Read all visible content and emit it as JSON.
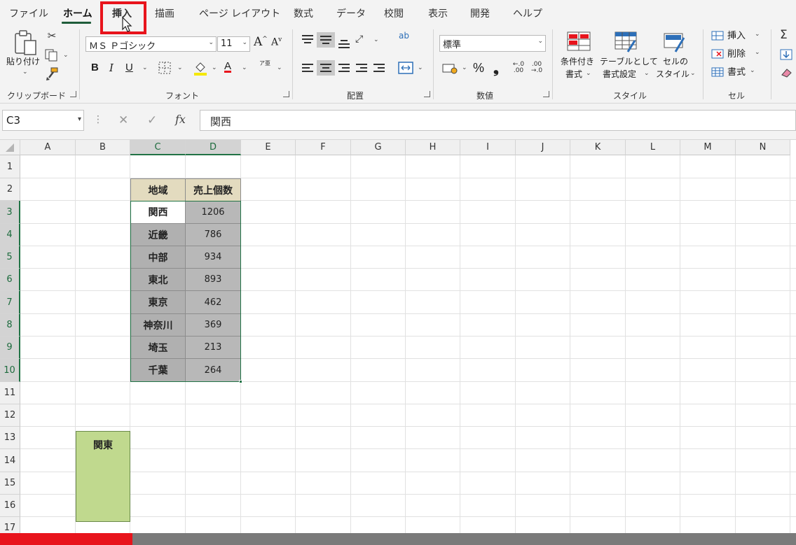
{
  "menu": {
    "tabs": [
      "ファイル",
      "ホーム",
      "挿入",
      "描画",
      "ページ レイアウト",
      "数式",
      "データ",
      "校閲",
      "表示",
      "開発",
      "ヘルプ"
    ],
    "active": "ホーム",
    "highlighted": "挿入"
  },
  "ribbon": {
    "clipboard": {
      "paste_label": "貼り付け",
      "group": "クリップボード"
    },
    "font": {
      "name": "ＭＳ Ｐゴシック",
      "size": "11",
      "bold": "B",
      "italic": "I",
      "underline": "U",
      "group": "フォント",
      "grow": "A",
      "shrink": "A",
      "color_letter": "A",
      "phonetic": "ア亜"
    },
    "alignment": {
      "group": "配置",
      "wrap_icon": "ab"
    },
    "number": {
      "format": "標準",
      "group": "数値",
      "percent": "%",
      "comma": "❟"
    },
    "styles": {
      "conditional": "条件付き\n書式",
      "conditional_line1": "条件付き",
      "conditional_line2": "書式",
      "table_line1": "テーブルとして",
      "table_line2": "書式設定",
      "cell_line1": "セルの",
      "cell_line2": "スタイル",
      "group": "スタイル"
    },
    "cells": {
      "insert": "挿入",
      "delete": "削除",
      "format": "書式",
      "group": "セル"
    }
  },
  "formula_bar": {
    "name_box": "C3",
    "fx": "fx",
    "value": "関西"
  },
  "sheet": {
    "columns": [
      "A",
      "B",
      "C",
      "D",
      "E",
      "F",
      "G",
      "H",
      "I",
      "J",
      "K",
      "L",
      "M",
      "N"
    ],
    "selected_columns": [
      "C",
      "D"
    ],
    "rows": [
      "1",
      "2",
      "3",
      "4",
      "5",
      "6",
      "7",
      "8",
      "9",
      "10",
      "11",
      "12",
      "13",
      "14",
      "15",
      "16",
      "17"
    ],
    "selected_rows": [
      "3",
      "4",
      "5",
      "6",
      "7",
      "8",
      "9",
      "10"
    ],
    "headers": {
      "C2": "地域",
      "D2": "売上個数"
    },
    "table": [
      {
        "region": "関西",
        "sales": "1206"
      },
      {
        "region": "近畿",
        "sales": "786"
      },
      {
        "region": "中部",
        "sales": "934"
      },
      {
        "region": "東北",
        "sales": "893"
      },
      {
        "region": "東京",
        "sales": "462"
      },
      {
        "region": "神奈川",
        "sales": "369"
      },
      {
        "region": "埼玉",
        "sales": "213"
      },
      {
        "region": "千葉",
        "sales": "264"
      }
    ],
    "merged_B7_B10": "関東",
    "active_cell": "C3"
  },
  "progress": {
    "fraction": 0.166,
    "color": "#e8141c"
  },
  "colors": {
    "accent": "#217346",
    "highlight": "#e8141c",
    "header_fill": "#e3dbbf",
    "kanto_fill": "#c0d98e"
  }
}
